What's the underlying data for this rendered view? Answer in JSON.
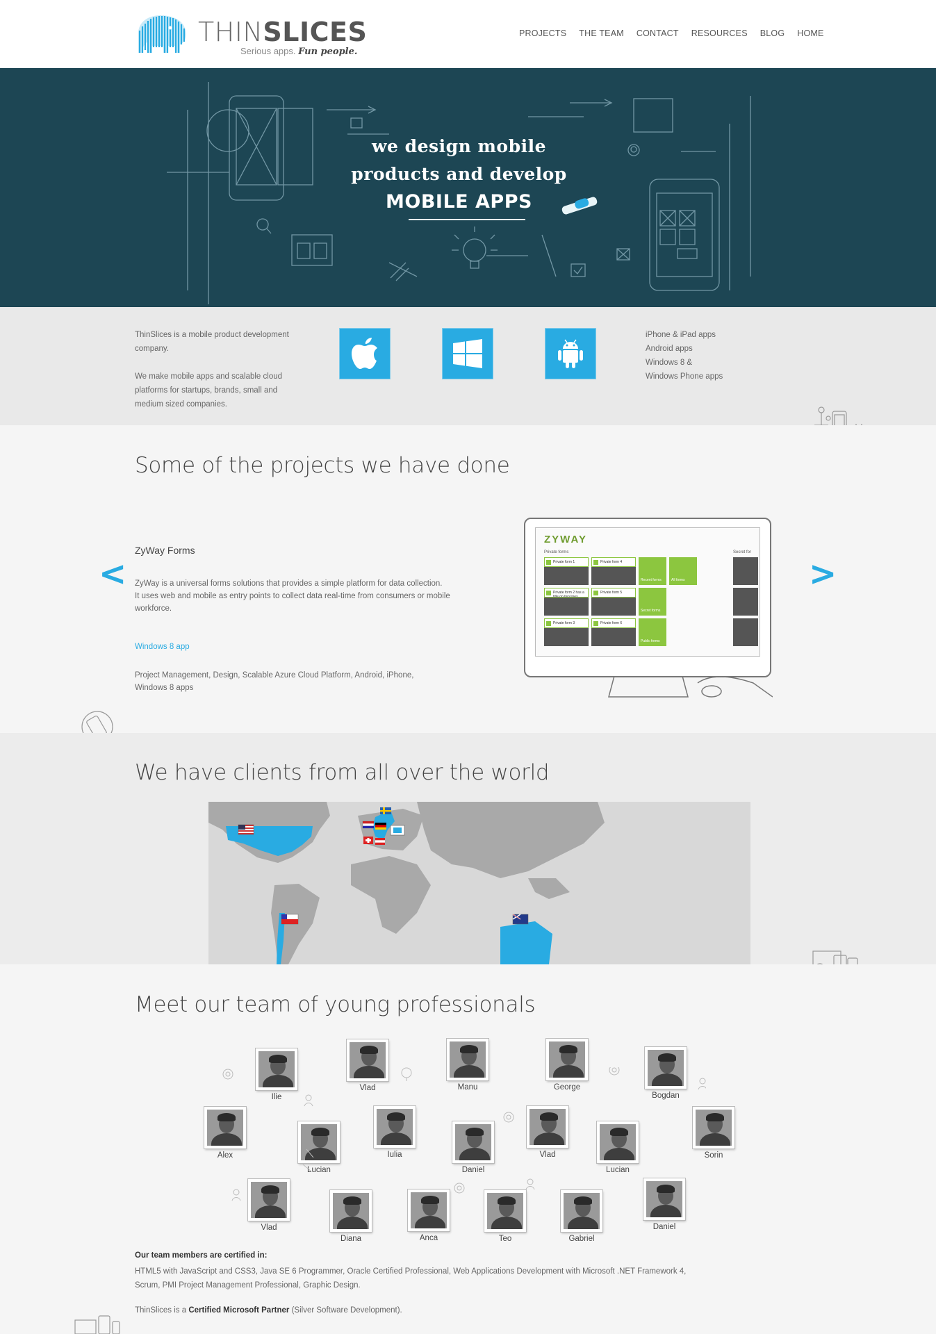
{
  "header": {
    "logo_thin": "THIN",
    "logo_slices": "SLICES",
    "tagline_serious": "Serious apps.",
    "tagline_fun": "Fun people.",
    "nav": [
      "PROJECTS",
      "THE TEAM",
      "CONTACT",
      "RESOURCES",
      "BLOG",
      "HOME"
    ]
  },
  "hero": {
    "line1": "we design mobile",
    "line2": "products and develop",
    "line3": "MOBILE APPS"
  },
  "intro": {
    "p1": "ThinSlices is a mobile product development company.",
    "p2": "We make mobile apps and scalable cloud platforms for startups, brands, small and medium sized companies.",
    "platforms": [
      "apple-icon",
      "windows-icon",
      "android-icon"
    ],
    "platform_list": [
      "iPhone & iPad apps",
      "Android apps",
      "Windows 8 &",
      "Windows Phone apps"
    ]
  },
  "projects": {
    "title": "Some of the projects we have done",
    "prev": "<",
    "next": ">",
    "name": "ZyWay Forms",
    "desc1": "ZyWay is a universal forms solutions that provides a simple platform for data collection.",
    "desc2": "It uses web and mobile as entry points to collect data real-time from consumers or mobile workforce.",
    "link": "Windows 8 app",
    "tech": "Project Management, Design, Scalable Azure Cloud Platform, Android, iPhone, Windows 8 apps",
    "screen": {
      "brand": "ZYWAY",
      "private_forms": "Private forms",
      "secret_forms": "Secret for",
      "tiles": [
        "Private form 1",
        "Private form 4",
        "Private form 2 has a title on two lines",
        "Private form 5",
        "Private form 3",
        "Private form 6"
      ],
      "green_tiles": [
        "Recent forms",
        "All forms",
        "Secret forms",
        "Public forms"
      ]
    }
  },
  "clients": {
    "title": "We have clients from all over the world"
  },
  "team": {
    "title": "Meet our team of young professionals",
    "members": [
      "Ilie",
      "Vlad",
      "Manu",
      "George",
      "Bogdan",
      "Alex",
      "Lucian",
      "Iulia",
      "Daniel",
      "Vlad",
      "Lucian",
      "Sorin",
      "Vlad",
      "Diana",
      "Anca",
      "Teo",
      "Gabriel",
      "Daniel"
    ],
    "cert_title": "Our team members are certified in:",
    "cert_text": "HTML5 with JavaScript and CSS3, Java SE 6 Programmer, Oracle Certified Professional, Web Applications Development with Microsoft .NET Framework 4, Scrum, PMI Project Management Professional, Graphic Design.",
    "partner_prefix": "ThinSlices is a ",
    "partner_bold": "Certified Microsoft Partner",
    "partner_suffix": " (Silver Software Development)."
  },
  "colors": {
    "accent": "#29abe2",
    "hero_bg": "#1d4654",
    "zyway_green": "#8cc63f"
  }
}
